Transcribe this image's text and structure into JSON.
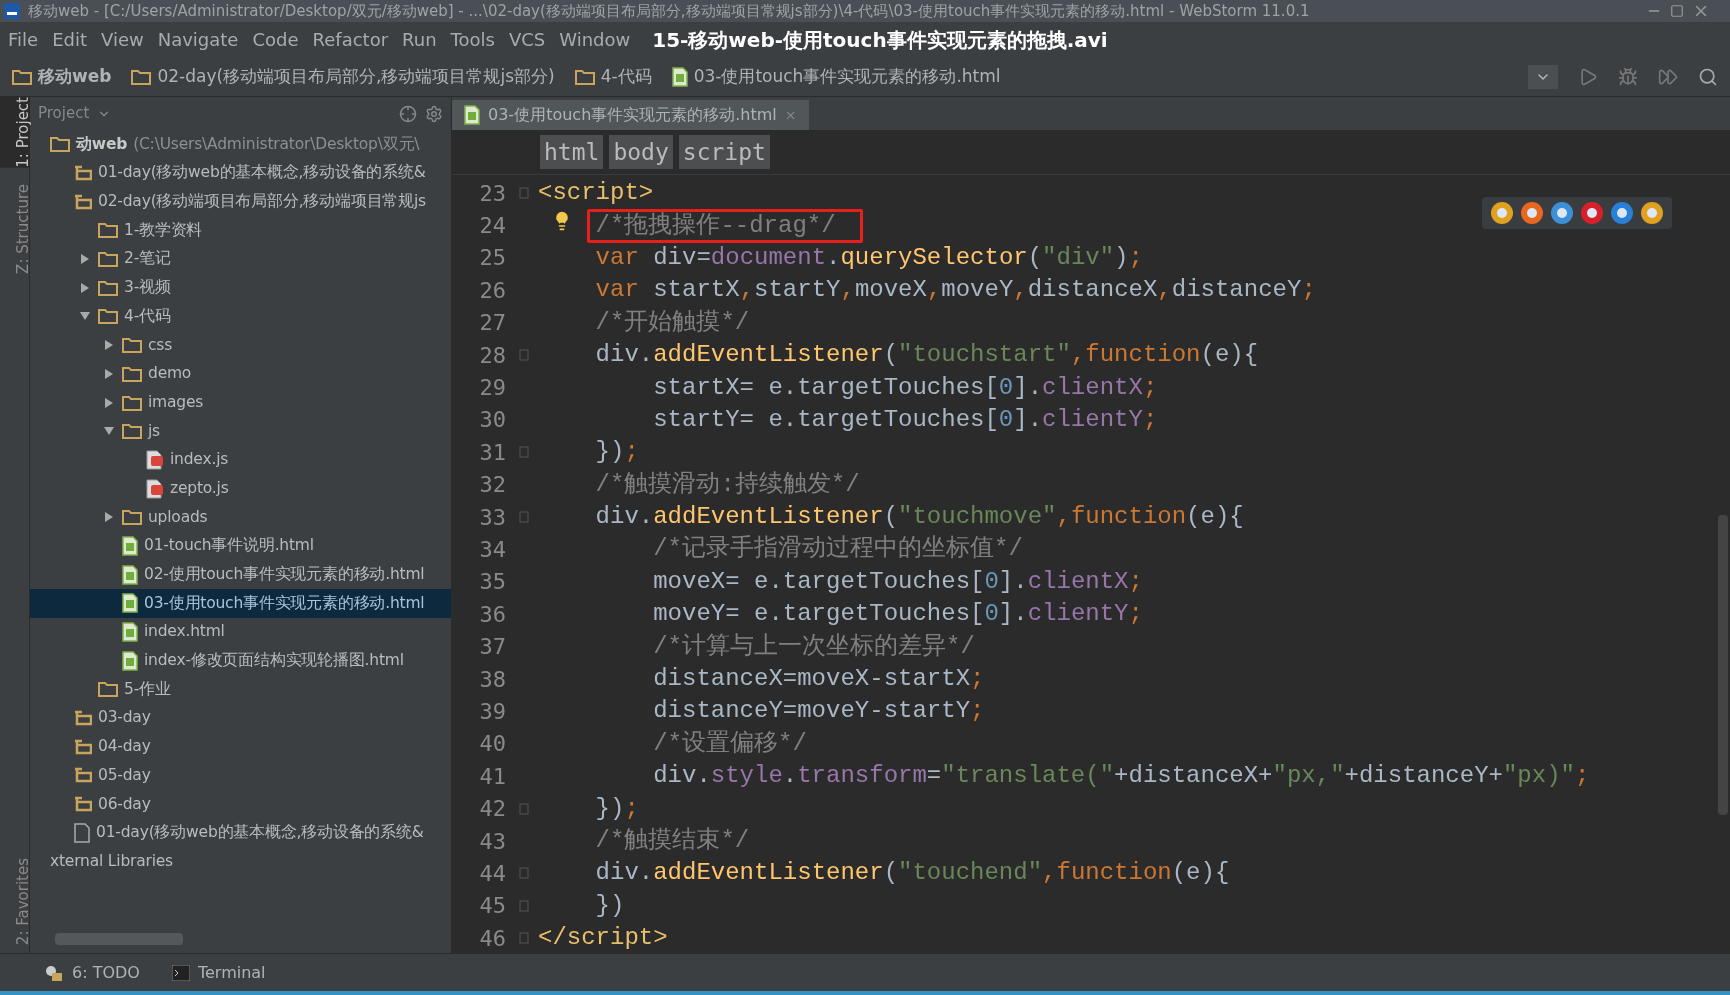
{
  "window": {
    "title": "移动web - [C:/Users/Administrator/Desktop/双元/移动web] - ...\\02-day(移动端项目布局部分,移动端项目常规js部分)\\4-代码\\03-使用touch事件实现元素的移动.html - WebStorm 11.0.1"
  },
  "menu": [
    "File",
    "Edit",
    "View",
    "Navigate",
    "Code",
    "Refactor",
    "Run",
    "Tools",
    "VCS",
    "Window"
  ],
  "video_title": "15-移动web-使用touch事件实现元素的拖拽.avi",
  "breadcrumbs": [
    {
      "label": "移动web",
      "kind": "folder"
    },
    {
      "label": "02-day(移动端项目布局部分,移动端项目常规js部分)",
      "kind": "folder"
    },
    {
      "label": "4-代码",
      "kind": "folder"
    },
    {
      "label": "03-使用touch事件实现元素的移动.html",
      "kind": "html"
    }
  ],
  "side_tabs_top": [
    {
      "label": "1: Project",
      "selected": true
    },
    {
      "label": "Z: Structure",
      "selected": false
    }
  ],
  "side_tabs_bottom": [
    {
      "label": "2: Favorites",
      "selected": false
    }
  ],
  "project_panel": {
    "title": "Project",
    "tree": [
      {
        "label": "动web",
        "detail": "(C:\\Users\\Administrator\\Desktop\\双元\\",
        "kind": "root",
        "selected": false,
        "children": [
          {
            "label": "01-day(移动web的基本概念,移动设备的系统&",
            "kind": "module",
            "selected": false
          },
          {
            "label": "02-day(移动端项目布局部分,移动端项目常规js",
            "kind": "module",
            "selected": false,
            "children": [
              {
                "label": "1-教学资料",
                "kind": "folder",
                "selected": false
              },
              {
                "label": "2-笔记",
                "kind": "folder",
                "expanded": false,
                "selected": false
              },
              {
                "label": "3-视频",
                "kind": "folder",
                "expanded": false,
                "selected": false
              },
              {
                "label": "4-代码",
                "kind": "folder",
                "expanded": true,
                "selected": false,
                "children": [
                  {
                    "label": "css",
                    "kind": "folder",
                    "expanded": false,
                    "selected": false
                  },
                  {
                    "label": "demo",
                    "kind": "folder",
                    "expanded": false,
                    "selected": false
                  },
                  {
                    "label": "images",
                    "kind": "folder",
                    "expanded": false,
                    "selected": false
                  },
                  {
                    "label": "js",
                    "kind": "folder",
                    "expanded": true,
                    "selected": false,
                    "children": [
                      {
                        "label": "index.js",
                        "kind": "js",
                        "selected": false
                      },
                      {
                        "label": "zepto.js",
                        "kind": "js",
                        "selected": false
                      }
                    ]
                  },
                  {
                    "label": "uploads",
                    "kind": "folder",
                    "expanded": false,
                    "selected": false
                  },
                  {
                    "label": "01-touch事件说明.html",
                    "kind": "html",
                    "selected": false
                  },
                  {
                    "label": "02-使用touch事件实现元素的移动.html",
                    "kind": "html",
                    "selected": false
                  },
                  {
                    "label": "03-使用touch事件实现元素的移动.html",
                    "kind": "html",
                    "selected": true
                  },
                  {
                    "label": "index.html",
                    "kind": "html",
                    "selected": false
                  },
                  {
                    "label": "index-修改页面结构实现轮播图.html",
                    "kind": "html",
                    "selected": false
                  }
                ]
              },
              {
                "label": "5-作业",
                "kind": "folder",
                "selected": false
              }
            ]
          },
          {
            "label": "03-day",
            "kind": "module",
            "selected": false
          },
          {
            "label": "04-day",
            "kind": "module",
            "selected": false
          },
          {
            "label": "05-day",
            "kind": "module",
            "selected": false
          },
          {
            "label": "06-day",
            "kind": "module",
            "selected": false
          },
          {
            "label": "01-day(移动web的基本概念,移动设备的系统&",
            "kind": "file",
            "selected": false
          }
        ]
      },
      {
        "label": "xternal Libraries",
        "kind": "library",
        "selected": false
      }
    ]
  },
  "editor": {
    "tab": {
      "label": "03-使用touch事件实现元素的移动.html",
      "close": "×"
    },
    "path": [
      "html",
      "body",
      "script"
    ],
    "lines": [
      {
        "number": "23",
        "fold": true,
        "tokens": [
          {
            "kind": "tag",
            "text": "<script>"
          }
        ],
        "children": [
          {
            "number": "24",
            "lightbulb": true,
            "boxed": true,
            "tokens": [
              {
                "kind": "comment",
                "text": "/*拖拽操作--drag*/"
              }
            ]
          },
          {
            "number": "25",
            "tokens": [
              {
                "kind": "keyword",
                "text": "var"
              },
              {
                "kind": "plain",
                "text": " div="
              },
              {
                "kind": "property",
                "text": "document"
              },
              {
                "kind": "plain",
                "text": "."
              },
              {
                "kind": "function",
                "text": "querySelector"
              },
              {
                "kind": "plain",
                "text": "("
              },
              {
                "kind": "string",
                "text": "\"div\""
              },
              {
                "kind": "plain",
                "text": ")"
              },
              {
                "kind": "keyword",
                "text": ";"
              }
            ]
          },
          {
            "number": "26",
            "tokens": [
              {
                "kind": "keyword",
                "text": "var"
              },
              {
                "kind": "plain",
                "text": " startX"
              },
              {
                "kind": "keyword",
                "text": ","
              },
              {
                "kind": "plain",
                "text": "startY"
              },
              {
                "kind": "keyword",
                "text": ","
              },
              {
                "kind": "plain",
                "text": "moveX"
              },
              {
                "kind": "keyword",
                "text": ","
              },
              {
                "kind": "plain",
                "text": "moveY"
              },
              {
                "kind": "keyword",
                "text": ","
              },
              {
                "kind": "plain",
                "text": "distanceX"
              },
              {
                "kind": "keyword",
                "text": ","
              },
              {
                "kind": "plain",
                "text": "distanceY"
              },
              {
                "kind": "keyword",
                "text": ";"
              }
            ]
          },
          {
            "number": "27",
            "tokens": [
              {
                "kind": "comment",
                "text": "/*开始触摸*/"
              }
            ]
          },
          {
            "number": "28",
            "fold": true,
            "tokens": [
              {
                "kind": "plain",
                "text": "div."
              },
              {
                "kind": "function",
                "text": "addEventListener"
              },
              {
                "kind": "plain",
                "text": "("
              },
              {
                "kind": "string",
                "text": "\"touchstart\""
              },
              {
                "kind": "keyword",
                "text": ",function"
              },
              {
                "kind": "plain",
                "text": "(e){"
              }
            ],
            "children": [
              {
                "number": "29",
                "tokens": [
                  {
                    "kind": "plain",
                    "text": "startX= e.targetTouches["
                  },
                  {
                    "kind": "number",
                    "text": "0"
                  },
                  {
                    "kind": "plain",
                    "text": "]."
                  },
                  {
                    "kind": "property",
                    "text": "clientX"
                  },
                  {
                    "kind": "keyword",
                    "text": ";"
                  }
                ]
              },
              {
                "number": "30",
                "tokens": [
                  {
                    "kind": "plain",
                    "text": "startY= e.targetTouches["
                  },
                  {
                    "kind": "number",
                    "text": "0"
                  },
                  {
                    "kind": "plain",
                    "text": "]."
                  },
                  {
                    "kind": "property",
                    "text": "clientY"
                  },
                  {
                    "kind": "keyword",
                    "text": ";"
                  }
                ]
              }
            ]
          },
          {
            "number": "31",
            "fold": true,
            "tokens": [
              {
                "kind": "plain",
                "text": "})"
              },
              {
                "kind": "keyword",
                "text": ";"
              }
            ]
          },
          {
            "number": "32",
            "tokens": [
              {
                "kind": "comment",
                "text": "/*触摸滑动:持续触发*/"
              }
            ]
          },
          {
            "number": "33",
            "fold": true,
            "tokens": [
              {
                "kind": "plain",
                "text": "div."
              },
              {
                "kind": "function",
                "text": "addEventListener"
              },
              {
                "kind": "plain",
                "text": "("
              },
              {
                "kind": "string",
                "text": "\"touchmove\""
              },
              {
                "kind": "keyword",
                "text": ",function"
              },
              {
                "kind": "plain",
                "text": "(e){"
              }
            ],
            "children": [
              {
                "number": "34",
                "tokens": [
                  {
                    "kind": "comment",
                    "text": "/*记录手指滑动过程中的坐标值*/"
                  }
                ]
              },
              {
                "number": "35",
                "tokens": [
                  {
                    "kind": "plain",
                    "text": "moveX= e.targetTouches["
                  },
                  {
                    "kind": "number",
                    "text": "0"
                  },
                  {
                    "kind": "plain",
                    "text": "]."
                  },
                  {
                    "kind": "property",
                    "text": "clientX"
                  },
                  {
                    "kind": "keyword",
                    "text": ";"
                  }
                ]
              },
              {
                "number": "36",
                "tokens": [
                  {
                    "kind": "plain",
                    "text": "moveY= e.targetTouches["
                  },
                  {
                    "kind": "number",
                    "text": "0"
                  },
                  {
                    "kind": "plain",
                    "text": "]."
                  },
                  {
                    "kind": "property",
                    "text": "clientY"
                  },
                  {
                    "kind": "keyword",
                    "text": ";"
                  }
                ]
              },
              {
                "number": "37",
                "tokens": [
                  {
                    "kind": "comment",
                    "text": "/*计算与上一次坐标的差异*/"
                  }
                ]
              },
              {
                "number": "38",
                "tokens": [
                  {
                    "kind": "plain",
                    "text": "distanceX=moveX-startX"
                  },
                  {
                    "kind": "keyword",
                    "text": ";"
                  }
                ]
              },
              {
                "number": "39",
                "tokens": [
                  {
                    "kind": "plain",
                    "text": "distanceY=moveY-startY"
                  },
                  {
                    "kind": "keyword",
                    "text": ";"
                  }
                ]
              },
              {
                "number": "40",
                "tokens": [
                  {
                    "kind": "comment",
                    "text": "/*设置偏移*/"
                  }
                ]
              },
              {
                "number": "41",
                "tokens": [
                  {
                    "kind": "plain",
                    "text": "div."
                  },
                  {
                    "kind": "property",
                    "text": "style"
                  },
                  {
                    "kind": "plain",
                    "text": "."
                  },
                  {
                    "kind": "property",
                    "text": "transform"
                  },
                  {
                    "kind": "plain",
                    "text": "="
                  },
                  {
                    "kind": "string",
                    "text": "\"translate(\""
                  },
                  {
                    "kind": "plain",
                    "text": "+distanceX+"
                  },
                  {
                    "kind": "string",
                    "text": "\"px,\""
                  },
                  {
                    "kind": "plain",
                    "text": "+distanceY+"
                  },
                  {
                    "kind": "string",
                    "text": "\"px)\""
                  },
                  {
                    "kind": "keyword",
                    "text": ";"
                  }
                ]
              }
            ]
          },
          {
            "number": "42",
            "fold": true,
            "tokens": [
              {
                "kind": "plain",
                "text": "})"
              },
              {
                "kind": "keyword",
                "text": ";"
              }
            ]
          },
          {
            "number": "43",
            "tokens": [
              {
                "kind": "comment",
                "text": "/*触摸结束*/"
              }
            ]
          },
          {
            "number": "44",
            "fold": true,
            "tokens": [
              {
                "kind": "plain",
                "text": "div."
              },
              {
                "kind": "function",
                "text": "addEventListener"
              },
              {
                "kind": "plain",
                "text": "("
              },
              {
                "kind": "string",
                "text": "\"touchend\""
              },
              {
                "kind": "keyword",
                "text": ",function"
              },
              {
                "kind": "plain",
                "text": "(e){"
              }
            ]
          },
          {
            "number": "45",
            "fold": true,
            "tokens": [
              {
                "kind": "plain",
                "text": "})"
              }
            ]
          }
        ]
      },
      {
        "number": "46",
        "fold": true,
        "tokens": [
          {
            "kind": "tag",
            "text": "</script>"
          }
        ]
      }
    ]
  },
  "bottom_tools": [
    {
      "label": "6: TODO",
      "kind": "todo"
    },
    {
      "label": "Terminal",
      "kind": "terminal"
    }
  ]
}
